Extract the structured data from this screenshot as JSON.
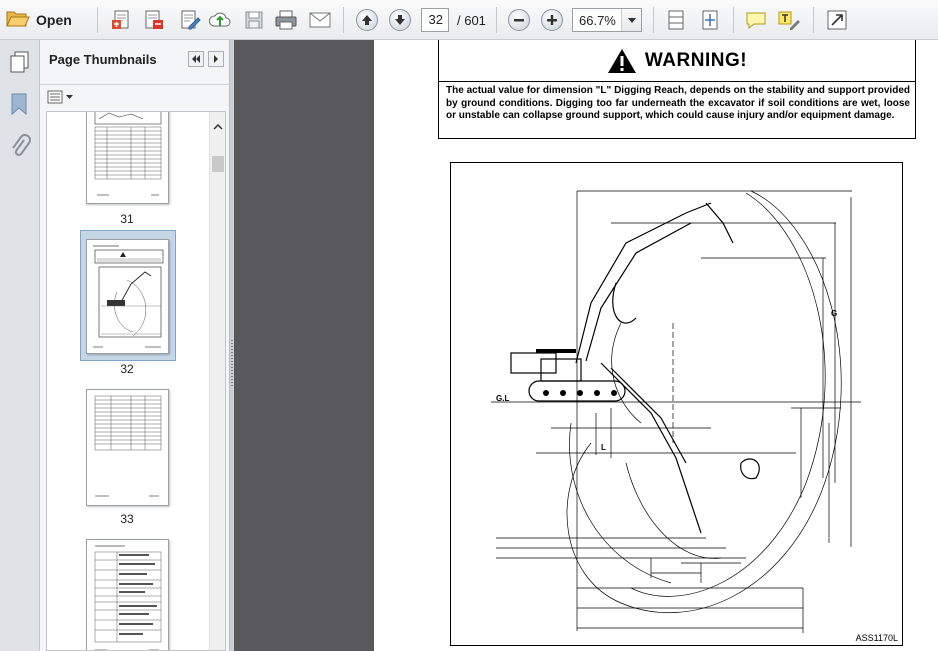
{
  "toolbar": {
    "open_label": "Open",
    "current_page": "32",
    "page_total": "/ 601",
    "zoom": "66.7%",
    "icons": [
      "folder-open-icon",
      "create-pdf-icon",
      "export-pdf-icon",
      "edit-pdf-icon",
      "upload-icon",
      "save-icon",
      "print-icon",
      "email-icon",
      "previous-page-icon",
      "next-page-icon",
      "zoom-out-icon",
      "zoom-in-icon",
      "fit-width-icon",
      "fit-page-icon",
      "comment-icon",
      "highlight-text-icon",
      "fullscreen-icon"
    ]
  },
  "panel": {
    "title": "Page Thumbnails",
    "thumbnails": [
      {
        "label": "31",
        "selected": false
      },
      {
        "label": "32",
        "selected": true
      },
      {
        "label": "33",
        "selected": false
      }
    ]
  },
  "document": {
    "warning_title": "WARNING!",
    "warning_text": "The actual value for dimension \"L\" Digging Reach, depends on the stability and support provided by ground conditions. Digging too far underneath the excavator if soil conditions are wet, loose or unstable can collapse ground support, which could cause injury and/or equipment damage.",
    "figure_code": "ASS1170L",
    "figure_labels": {
      "ground_line": "G.L",
      "dim_l": "L",
      "dim_g": "G"
    }
  }
}
